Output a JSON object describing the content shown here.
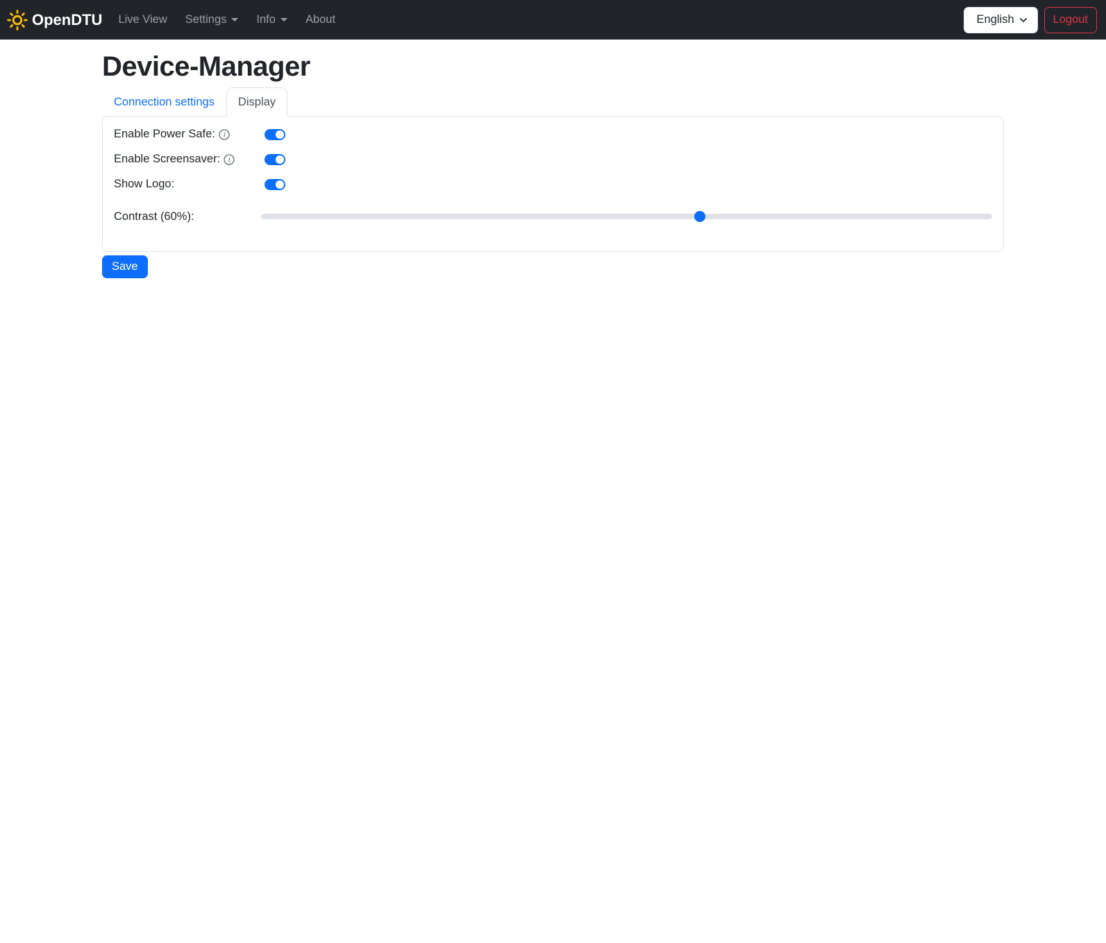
{
  "navbar": {
    "brand": "OpenDTU",
    "items": [
      {
        "label": "Live View",
        "has_caret": false
      },
      {
        "label": "Settings",
        "has_caret": true
      },
      {
        "label": "Info",
        "has_caret": true
      },
      {
        "label": "About",
        "has_caret": false
      }
    ],
    "language": "English",
    "logout_label": "Logout"
  },
  "page": {
    "title": "Device-Manager"
  },
  "tabs": [
    {
      "label": "Connection settings",
      "active": false
    },
    {
      "label": "Display",
      "active": true
    }
  ],
  "form": {
    "rows": [
      {
        "label": "Enable Power Safe:",
        "type": "switch",
        "value": true,
        "has_info": true
      },
      {
        "label": "Enable Screensaver:",
        "type": "switch",
        "value": true,
        "has_info": true
      },
      {
        "label": "Show Logo:",
        "type": "switch",
        "value": true,
        "has_info": false
      },
      {
        "label": "Contrast (60%):",
        "type": "range",
        "value": 60,
        "min": 0,
        "max": 100
      }
    ],
    "save_label": "Save"
  },
  "icons": {
    "brand": "sun-icon",
    "nav_caret": "caret-down-icon",
    "language": "chevron-down-icon",
    "field_help": "info-circle-icon"
  },
  "colors": {
    "navbar_bg": "#212529",
    "accent_blue": "#0d6efd",
    "danger_red": "#dc3545",
    "sun_yellow": "#ffc107",
    "border_gray": "#dee2e6",
    "active_tab_text": "#495057",
    "nav_link_gray": "rgba(255,255,255,0.55)"
  }
}
